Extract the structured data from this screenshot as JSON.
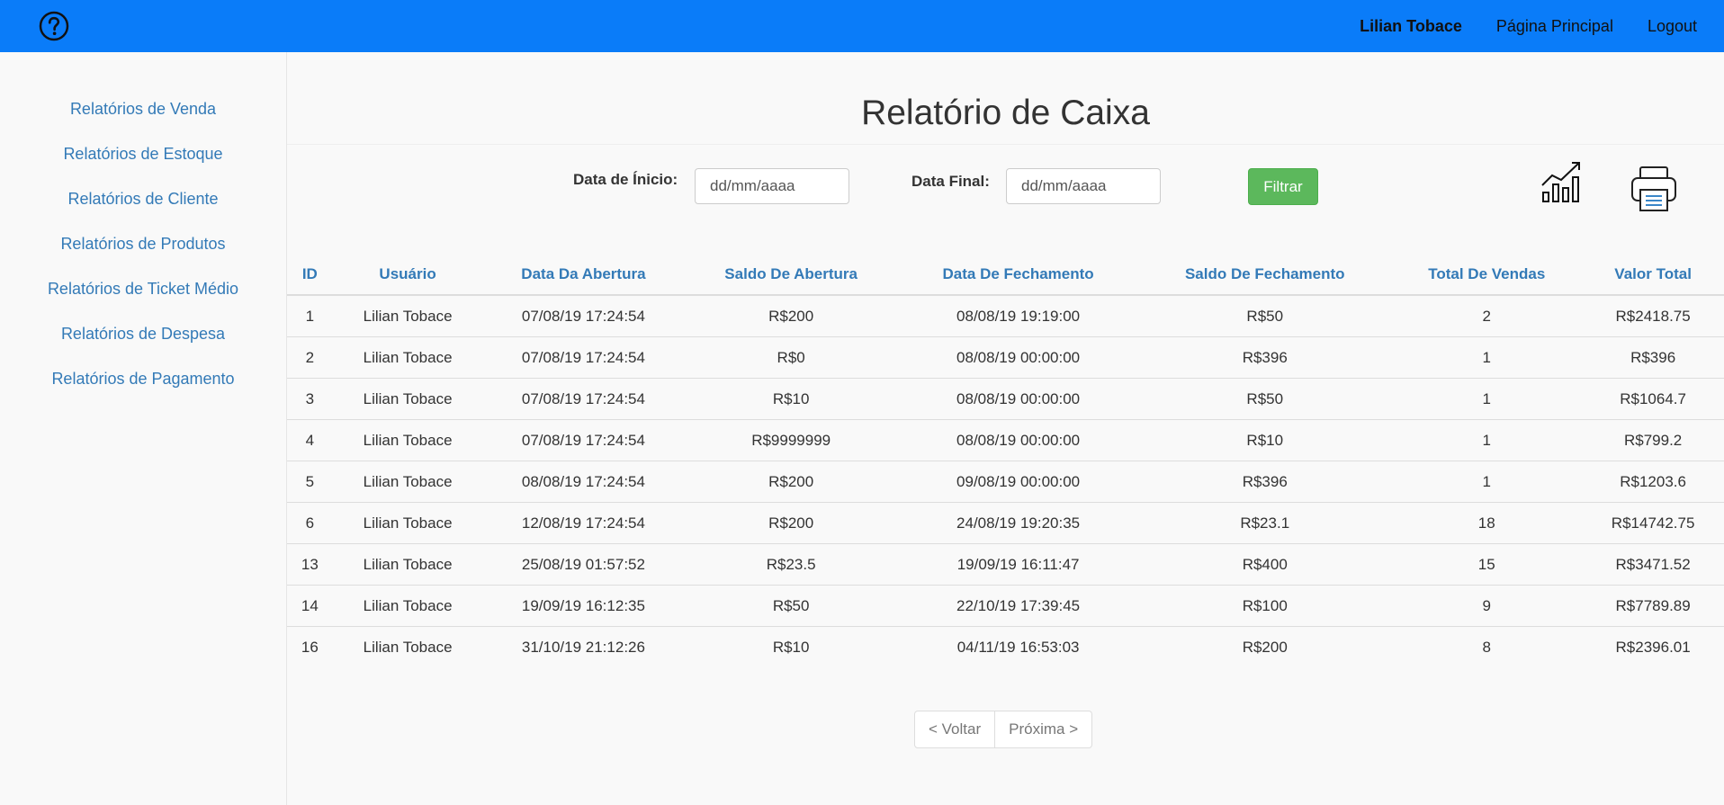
{
  "header": {
    "help_icon": "question-circle-icon",
    "user_name": "Lilian Tobace",
    "home_link": "Página Principal",
    "logout_link": "Logout"
  },
  "sidebar": {
    "items": [
      {
        "label": "Relatórios de Venda"
      },
      {
        "label": "Relatórios de Estoque"
      },
      {
        "label": "Relatórios de Cliente"
      },
      {
        "label": "Relatórios de Produtos"
      },
      {
        "label": "Relatórios de Ticket Médio"
      },
      {
        "label": "Relatórios de Despesa"
      },
      {
        "label": "Relatórios de Pagamento"
      }
    ]
  },
  "main": {
    "title": "Relatório de Caixa",
    "filter": {
      "start_label": "Data de Ínicio:",
      "start_placeholder": "dd/mm/aaaa",
      "end_label": "Data Final:",
      "end_placeholder": "dd/mm/aaaa",
      "filter_button": "Filtrar"
    },
    "icons": {
      "chart": "chart-growth-icon",
      "print": "printer-icon"
    },
    "table": {
      "headers": [
        "ID",
        "Usuário",
        "Data Da Abertura",
        "Saldo De Abertura",
        "Data De Fechamento",
        "Saldo De Fechamento",
        "Total De Vendas",
        "Valor Total"
      ],
      "rows": [
        [
          "1",
          "Lilian Tobace",
          "07/08/19 17:24:54",
          "R$200",
          "08/08/19 19:19:00",
          "R$50",
          "2",
          "R$2418.75"
        ],
        [
          "2",
          "Lilian Tobace",
          "07/08/19 17:24:54",
          "R$0",
          "08/08/19 00:00:00",
          "R$396",
          "1",
          "R$396"
        ],
        [
          "3",
          "Lilian Tobace",
          "07/08/19 17:24:54",
          "R$10",
          "08/08/19 00:00:00",
          "R$50",
          "1",
          "R$1064.7"
        ],
        [
          "4",
          "Lilian Tobace",
          "07/08/19 17:24:54",
          "R$9999999",
          "08/08/19 00:00:00",
          "R$10",
          "1",
          "R$799.2"
        ],
        [
          "5",
          "Lilian Tobace",
          "08/08/19 17:24:54",
          "R$200",
          "09/08/19 00:00:00",
          "R$396",
          "1",
          "R$1203.6"
        ],
        [
          "6",
          "Lilian Tobace",
          "12/08/19 17:24:54",
          "R$200",
          "24/08/19 19:20:35",
          "R$23.1",
          "18",
          "R$14742.75"
        ],
        [
          "13",
          "Lilian Tobace",
          "25/08/19 01:57:52",
          "R$23.5",
          "19/09/19 16:11:47",
          "R$400",
          "15",
          "R$3471.52"
        ],
        [
          "14",
          "Lilian Tobace",
          "19/09/19 16:12:35",
          "R$50",
          "22/10/19 17:39:45",
          "R$100",
          "9",
          "R$7789.89"
        ],
        [
          "16",
          "Lilian Tobace",
          "31/10/19 21:12:26",
          "R$10",
          "04/11/19 16:53:03",
          "R$200",
          "8",
          "R$2396.01"
        ]
      ]
    },
    "pagination": {
      "prev": "< Voltar",
      "next": "Próxima >"
    }
  },
  "colors": {
    "topbar": "#0a7cf9",
    "link": "#337ab7",
    "filter_button": "#5cb85c"
  }
}
